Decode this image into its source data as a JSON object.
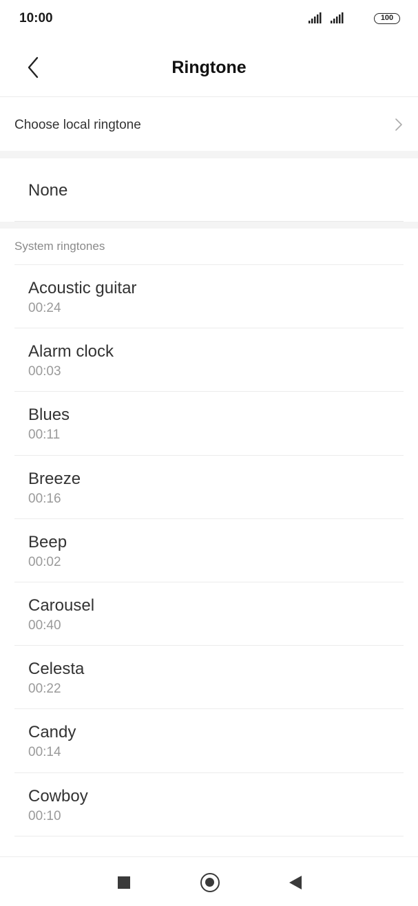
{
  "status_bar": {
    "time": "10:00",
    "battery": "100"
  },
  "header": {
    "title": "Ringtone"
  },
  "local": {
    "label": "Choose local ringtone"
  },
  "none": {
    "label": "None"
  },
  "section": {
    "title": "System ringtones"
  },
  "ringtones": [
    {
      "name": "Acoustic guitar",
      "duration": "00:24"
    },
    {
      "name": "Alarm clock",
      "duration": "00:03"
    },
    {
      "name": "Blues",
      "duration": "00:11"
    },
    {
      "name": "Breeze",
      "duration": "00:16"
    },
    {
      "name": "Beep",
      "duration": "00:02"
    },
    {
      "name": "Carousel",
      "duration": "00:40"
    },
    {
      "name": "Celesta",
      "duration": "00:22"
    },
    {
      "name": "Candy",
      "duration": "00:14"
    },
    {
      "name": "Cowboy",
      "duration": "00:10"
    }
  ]
}
